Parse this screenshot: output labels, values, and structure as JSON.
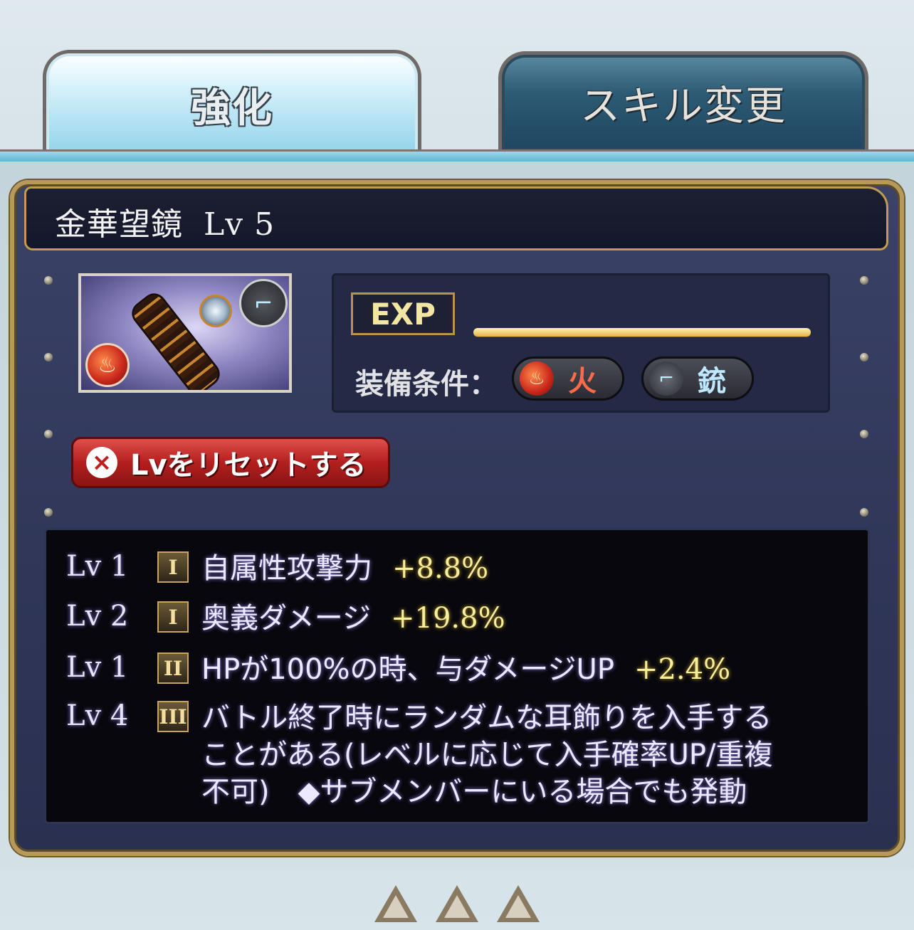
{
  "tabs": [
    {
      "label": "強化",
      "active": true
    },
    {
      "label": "スキル変更",
      "active": false
    }
  ],
  "item": {
    "name": "金華望鏡",
    "level_text": "Lv 5",
    "element_icon": "fire-icon",
    "weapon_icon": "gun-icon"
  },
  "exp": {
    "label": "EXP",
    "progress": 1.0
  },
  "requirements": {
    "label": "装備条件：",
    "element": {
      "icon": "fire-icon",
      "label": "火"
    },
    "weapon": {
      "icon": "gun-icon",
      "label": "銃"
    }
  },
  "reset_button": {
    "label": "Lvをリセットする",
    "icon": "close-icon"
  },
  "skills": [
    {
      "lv": "Lv 1",
      "rank": "I",
      "description": "自属性攻撃力",
      "value": "+8.8%"
    },
    {
      "lv": "Lv 2",
      "rank": "I",
      "description": "奥義ダメージ",
      "value": "+19.8%"
    },
    {
      "lv": "Lv 1",
      "rank": "II",
      "description": "HPが100%の時、与ダメージUP",
      "value": "+2.4%"
    },
    {
      "lv": "Lv 4",
      "rank": "III",
      "description_lines": [
        "バトル終了時にランダムな耳飾りを入手する",
        "ことがある(レベルに応じて入手確率UP/重複",
        "不可)　◆サブメンバーにいる場合でも発動"
      ]
    }
  ],
  "colors": {
    "accent_gold": "#b79a5a",
    "skill_value": "#f6ee9a",
    "reset_red": "#b31f1f"
  }
}
